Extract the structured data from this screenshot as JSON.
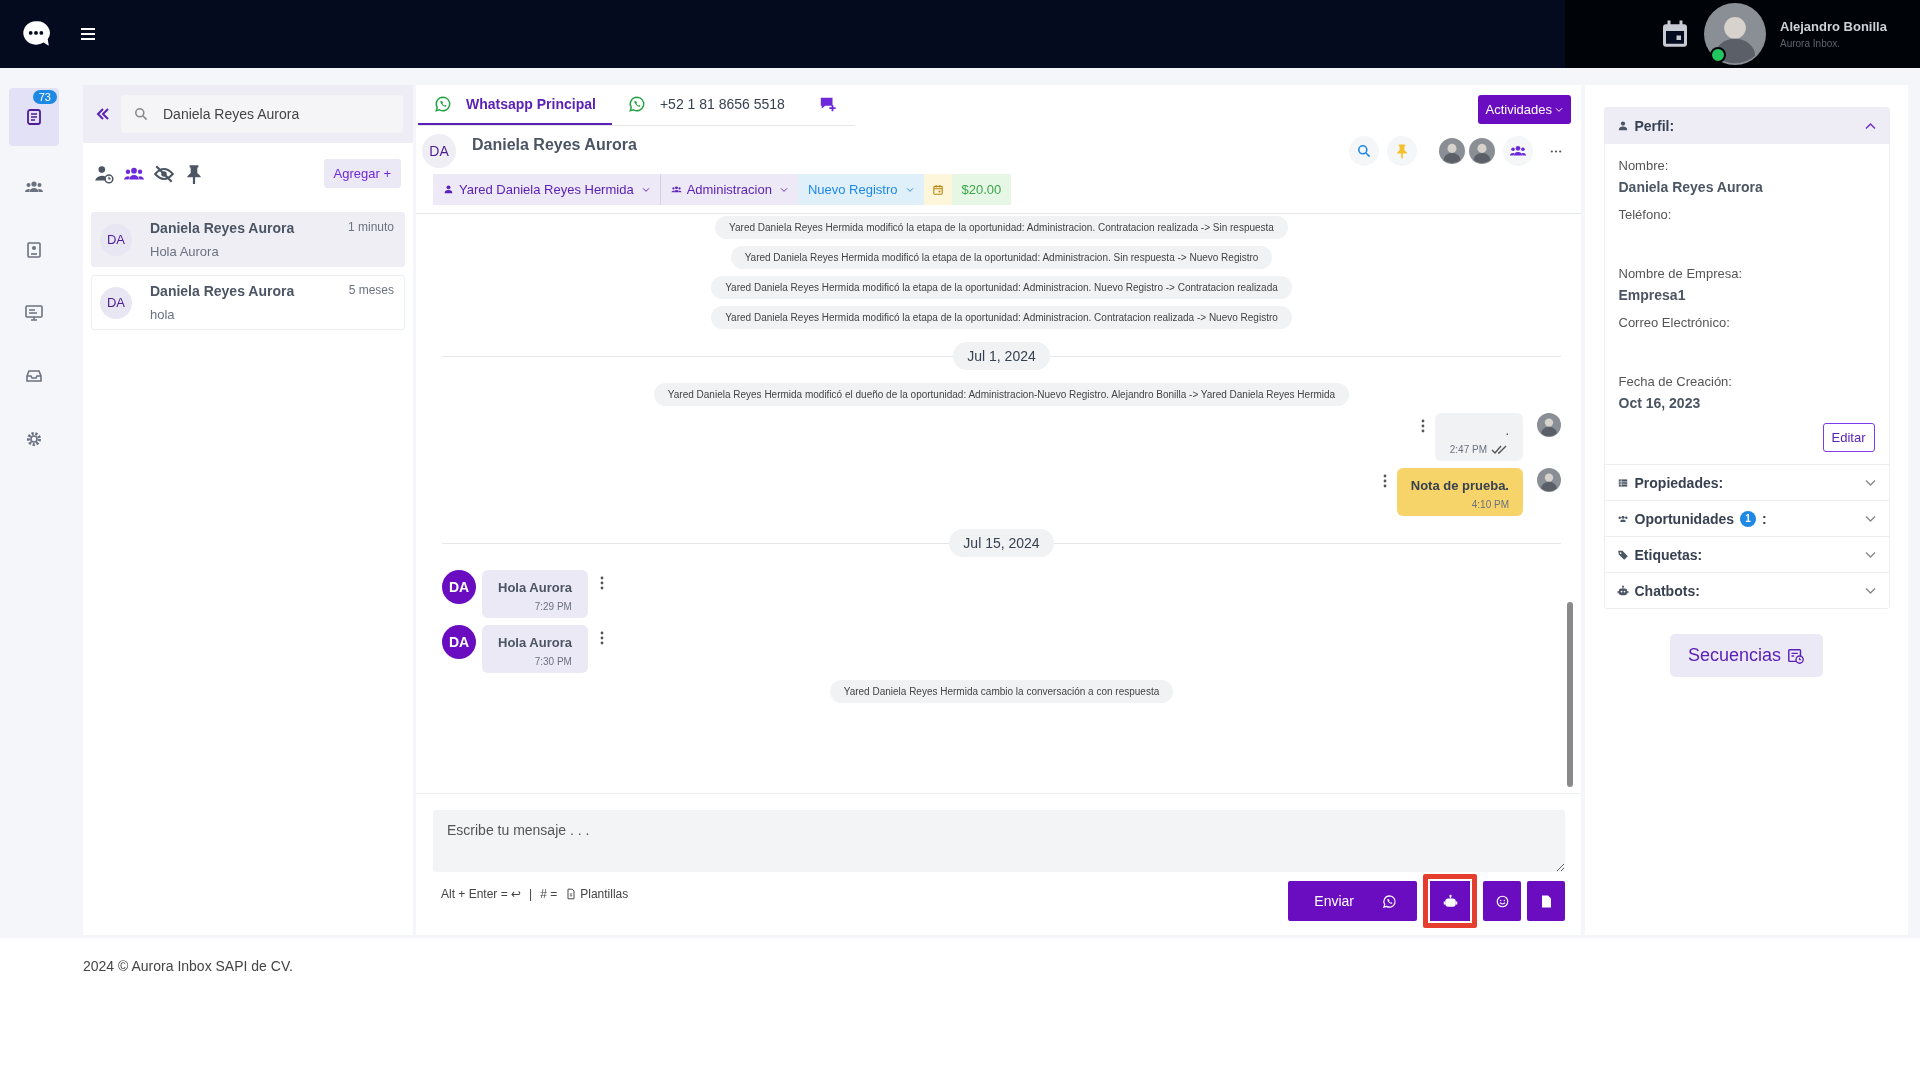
{
  "top_bar": {
    "user": {
      "name": "Alejandro Bonilla",
      "subtitle": "Aurora Inbox.",
      "online": true
    }
  },
  "rail": [
    {
      "kind": "list",
      "selected": true,
      "badge": "73"
    },
    {
      "kind": "contacts",
      "selected": false
    },
    {
      "kind": "report",
      "selected": false
    },
    {
      "kind": "monitor",
      "selected": false
    },
    {
      "kind": "inbox",
      "selected": false
    },
    {
      "kind": "settings",
      "selected": false
    }
  ],
  "conversations": {
    "search": {
      "value": "Daniela Reyes Aurora"
    },
    "filters": [
      {
        "kind": "user-clock",
        "selected": false
      },
      {
        "kind": "group",
        "selected": true
      },
      {
        "kind": "eye-off",
        "selected": false
      },
      {
        "kind": "pin",
        "selected": false
      }
    ],
    "add_button": "Agregar +",
    "items": [
      {
        "initials": "DA",
        "name": "Daniela Reyes Aurora",
        "time": "1 minuto",
        "preview": "Hola Aurora",
        "selected": true
      },
      {
        "initials": "DA",
        "name": "Daniela Reyes Aurora",
        "time": "5 meses",
        "preview": "hola",
        "selected": false
      }
    ]
  },
  "chat": {
    "tabs": [
      {
        "kind": "whatsapp",
        "label": "Whatsapp Principal",
        "selected": true
      },
      {
        "kind": "whatsapp",
        "label": "+52 1 81 8656 5518",
        "selected": false
      },
      {
        "kind": "new-chat",
        "selected": false
      }
    ],
    "activities_button": "Actividades",
    "contact": {
      "initials": "DA",
      "name": "Daniela Reyes Aurora"
    },
    "tags": [
      {
        "kind": "user",
        "label": "Yared Daniela Reyes Hermida"
      },
      {
        "kind": "team",
        "label": "Administracion"
      },
      {
        "kind": "stage",
        "label": "Nuevo Registro"
      },
      {
        "kind": "calendar"
      },
      {
        "kind": "amount",
        "label": "$20.00"
      }
    ],
    "messages": [
      {
        "kind": "system",
        "text": "Yared Daniela Reyes Hermida modificó la etapa de la oportunidad: Administracion. Contratacion realizada -> Sin respuesta"
      },
      {
        "kind": "system",
        "text": "Yared Daniela Reyes Hermida modificó la etapa de la oportunidad: Administracion. Sin respuesta -> Nuevo Registro"
      },
      {
        "kind": "system",
        "text": "Yared Daniela Reyes Hermida modificó la etapa de la oportunidad: Administracion. Nuevo Registro -> Contratacion realizada"
      },
      {
        "kind": "system",
        "text": "Yared Daniela Reyes Hermida modificó la etapa de la oportunidad: Administracion. Contratacion realizada -> Nuevo Registro"
      },
      {
        "kind": "date",
        "text": "Jul 1, 2024"
      },
      {
        "kind": "system",
        "text": "Yared Daniela Reyes Hermida modificó el dueño de la oportunidad: Administracion-Nuevo Registro. Alejandro Bonilla -> Yared Daniela Reyes Hermida"
      },
      {
        "kind": "outgoing",
        "text": ".",
        "time": "2:47 PM",
        "read": true
      },
      {
        "kind": "note",
        "text": "Nota de prueba.",
        "time": "4:10 PM"
      },
      {
        "kind": "date",
        "text": "Jul 15, 2024"
      },
      {
        "kind": "incoming",
        "initials": "DA",
        "text": "Hola Aurora",
        "time": "7:29 PM"
      },
      {
        "kind": "incoming",
        "initials": "DA",
        "text": "Hola Aurora",
        "time": "7:30 PM"
      },
      {
        "kind": "system",
        "text": "Yared Daniela Reyes Hermida cambio la conversación a con respuesta"
      }
    ],
    "composer": {
      "placeholder": "Escribe tu mensaje . . .",
      "shortcut": "Alt + Enter = ↩",
      "separator": "|",
      "template_key": "# =",
      "template_label": "Plantillas",
      "buttons": [
        {
          "kind": "send",
          "label": "Enviar",
          "highlighted": false
        },
        {
          "kind": "bot",
          "highlighted": true
        },
        {
          "kind": "emoji",
          "highlighted": false
        },
        {
          "kind": "file",
          "highlighted": false
        }
      ]
    }
  },
  "profile": {
    "title": "Perfil:",
    "expanded": true,
    "fields": [
      {
        "label": "Nombre:",
        "value": "Daniela Reyes Aurora"
      },
      {
        "label": "Teléfono:"
      },
      {
        "label": "Nombre de Empresa:",
        "value": "Empresa1"
      },
      {
        "label": "Correo Electrónico:"
      },
      {
        "label": "Fecha de Creación:",
        "value": "Oct 16, 2023"
      }
    ],
    "edit_button": "Editar",
    "sections": [
      {
        "kind": "properties",
        "title": "Propiedades:",
        "expanded": false
      },
      {
        "kind": "opportunities",
        "title": "Oportunidades",
        "badge": "1",
        "suffix": ":",
        "expanded": false
      },
      {
        "kind": "tags",
        "title": "Etiquetas:",
        "expanded": false
      },
      {
        "kind": "bots",
        "title": "Chatbots:",
        "expanded": false
      }
    ],
    "sequences_button": "Secuencias"
  },
  "footer": "2024 © Aurora Inbox SAPI de CV."
}
